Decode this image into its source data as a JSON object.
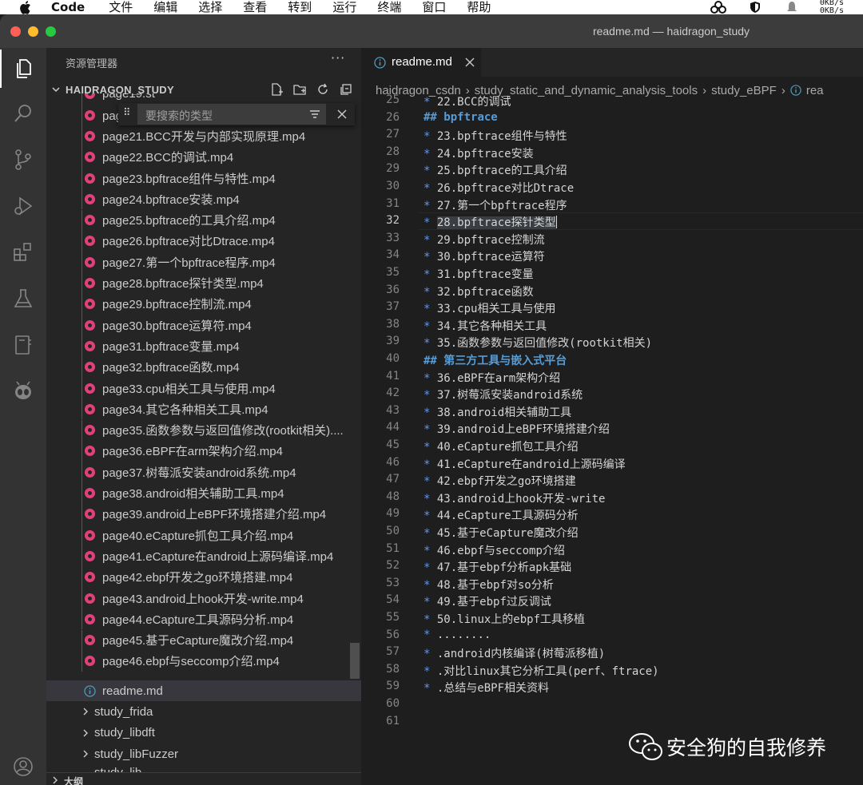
{
  "menubar": {
    "app_name": "Code",
    "items": [
      "文件",
      "编辑",
      "选择",
      "查看",
      "转到",
      "运行",
      "终端",
      "窗口",
      "帮助"
    ],
    "net_up": "0KB/s",
    "net_down": "0KB/s"
  },
  "window": {
    "title": "readme.md — haidragon_study"
  },
  "activity_bar": {
    "icons": [
      "explorer-icon",
      "search-icon",
      "source-control-icon",
      "run-debug-icon",
      "extensions-icon",
      "testing-icon",
      "notebook-icon",
      "alien-extension-icon",
      "account-icon"
    ]
  },
  "sidebar": {
    "title": "资源管理器",
    "more": "···",
    "section_label": "HAIDRAGON_STUDY",
    "partial_top": "page19.st",
    "items": [
      "page20.其",
      "page21.BCC开发与内部实现原理.mp4",
      "page22.BCC的调试.mp4",
      "page23.bpftrace组件与特性.mp4",
      "page24.bpftrace安装.mp4",
      "page25.bpftrace的工具介绍.mp4",
      "page26.bpftrace对比Dtrace.mp4",
      "page27.第一个bpftrace程序.mp4",
      "page28.bpftrace探针类型.mp4",
      "page29.bpftrace控制流.mp4",
      "page30.bpftrace运算符.mp4",
      "page31.bpftrace变量.mp4",
      "page32.bpftrace函数.mp4",
      "page33.cpu相关工具与使用.mp4",
      "page34.其它各种相关工具.mp4",
      "page35.函数参数与返回值修改(rootkit相关)....",
      "page36.eBPF在arm架构介绍.mp4",
      "page37.树莓派安装android系统.mp4",
      "page38.android相关辅助工具.mp4",
      "page39.android上eBPF环境搭建介绍.mp4",
      "page40.eCapture抓包工具介绍.mp4",
      "page41.eCapture在android上源码编译.mp4",
      "page42.ebpf开发之go环境搭建.mp4",
      "page43.android上hook开发-write.mp4",
      "page44.eCapture工具源码分析.mp4",
      "page45.基于eCapture魔改介绍.mp4",
      "page46.ebpf与seccomp介绍.mp4"
    ],
    "selected_file": "readme.md",
    "folders": [
      "study_frida",
      "study_libdft",
      "study_libFuzzer"
    ],
    "partial_bottom": "study_lib",
    "outline_label": "大纲"
  },
  "find_widget": {
    "placeholder": "要搜索的类型"
  },
  "editor": {
    "tab_label": "readme.md",
    "breadcrumb": [
      "haidragon_csdn",
      "study_static_and_dynamic_analysis_tools",
      "study_eBPF",
      "rea"
    ],
    "current_line": 32,
    "lines": [
      {
        "n": "25",
        "kind": "item",
        "text": "22.BCC的调试"
      },
      {
        "n": "26",
        "kind": "heading",
        "text": "bpftrace"
      },
      {
        "n": "27",
        "kind": "item",
        "text": "23.bpftrace组件与特性"
      },
      {
        "n": "28",
        "kind": "item",
        "text": "24.bpftrace安装"
      },
      {
        "n": "29",
        "kind": "item",
        "text": "25.bpftrace的工具介绍"
      },
      {
        "n": "30",
        "kind": "item",
        "text": "26.bpftrace对比Dtrace"
      },
      {
        "n": "31",
        "kind": "item",
        "text": "27.第一个bpftrace程序"
      },
      {
        "n": "32",
        "kind": "item",
        "text": "28.bpftrace探针类型"
      },
      {
        "n": "33",
        "kind": "item",
        "text": "29.bpftrace控制流"
      },
      {
        "n": "34",
        "kind": "item",
        "text": "30.bpftrace运算符"
      },
      {
        "n": "35",
        "kind": "item",
        "text": "31.bpftrace变量"
      },
      {
        "n": "36",
        "kind": "item",
        "text": "32.bpftrace函数"
      },
      {
        "n": "37",
        "kind": "item",
        "text": "33.cpu相关工具与使用"
      },
      {
        "n": "38",
        "kind": "item",
        "text": "34.其它各种相关工具"
      },
      {
        "n": "39",
        "kind": "item",
        "text": "35.函数参数与返回值修改(rootkit相关)"
      },
      {
        "n": "40",
        "kind": "heading",
        "text": "第三方工具与嵌入式平台"
      },
      {
        "n": "41",
        "kind": "item",
        "text": "36.eBPF在arm架构介绍"
      },
      {
        "n": "42",
        "kind": "item",
        "text": "37.树莓派安装android系统"
      },
      {
        "n": "43",
        "kind": "item",
        "text": "38.android相关辅助工具"
      },
      {
        "n": "44",
        "kind": "item",
        "text": "39.android上eBPF环境搭建介绍"
      },
      {
        "n": "45",
        "kind": "item",
        "text": "40.eCapture抓包工具介绍"
      },
      {
        "n": "46",
        "kind": "item",
        "text": "41.eCapture在android上源码编译"
      },
      {
        "n": "47",
        "kind": "item",
        "text": "42.ebpf开发之go环境搭建"
      },
      {
        "n": "48",
        "kind": "item",
        "text": "43.android上hook开发-write"
      },
      {
        "n": "49",
        "kind": "item",
        "text": "44.eCapture工具源码分析"
      },
      {
        "n": "50",
        "kind": "item",
        "text": "45.基于eCapture魔改介绍"
      },
      {
        "n": "51",
        "kind": "item",
        "text": "46.ebpf与seccomp介绍"
      },
      {
        "n": "52",
        "kind": "item",
        "text": "47.基于ebpf分析apk基础"
      },
      {
        "n": "53",
        "kind": "item",
        "text": "48.基于ebpf对so分析"
      },
      {
        "n": "54",
        "kind": "item",
        "text": "49.基于ebpf过反调试"
      },
      {
        "n": "55",
        "kind": "item",
        "text": "50.linux上的ebpf工具移植"
      },
      {
        "n": "56",
        "kind": "item",
        "text": "........"
      },
      {
        "n": "57",
        "kind": "item",
        "text": ".android内核编译(树莓派移植)"
      },
      {
        "n": "58",
        "kind": "item",
        "text": ".对比linux其它分析工具(perf、ftrace)"
      },
      {
        "n": "59",
        "kind": "item",
        "text": ".总结与eBPF相关资料"
      },
      {
        "n": "60",
        "kind": "empty",
        "text": ""
      },
      {
        "n": "61",
        "kind": "empty",
        "text": ""
      }
    ],
    "bullet": "*",
    "heading_marker": "##"
  },
  "watermark": {
    "text": "安全狗的自我修养"
  },
  "colors": {
    "record_icon": "#e2407a",
    "heading": "#569cd6",
    "bullet": "#6796e6",
    "sidebar_bg": "#252526",
    "editor_bg": "#1e1e1e",
    "activity_bg": "#333333"
  }
}
